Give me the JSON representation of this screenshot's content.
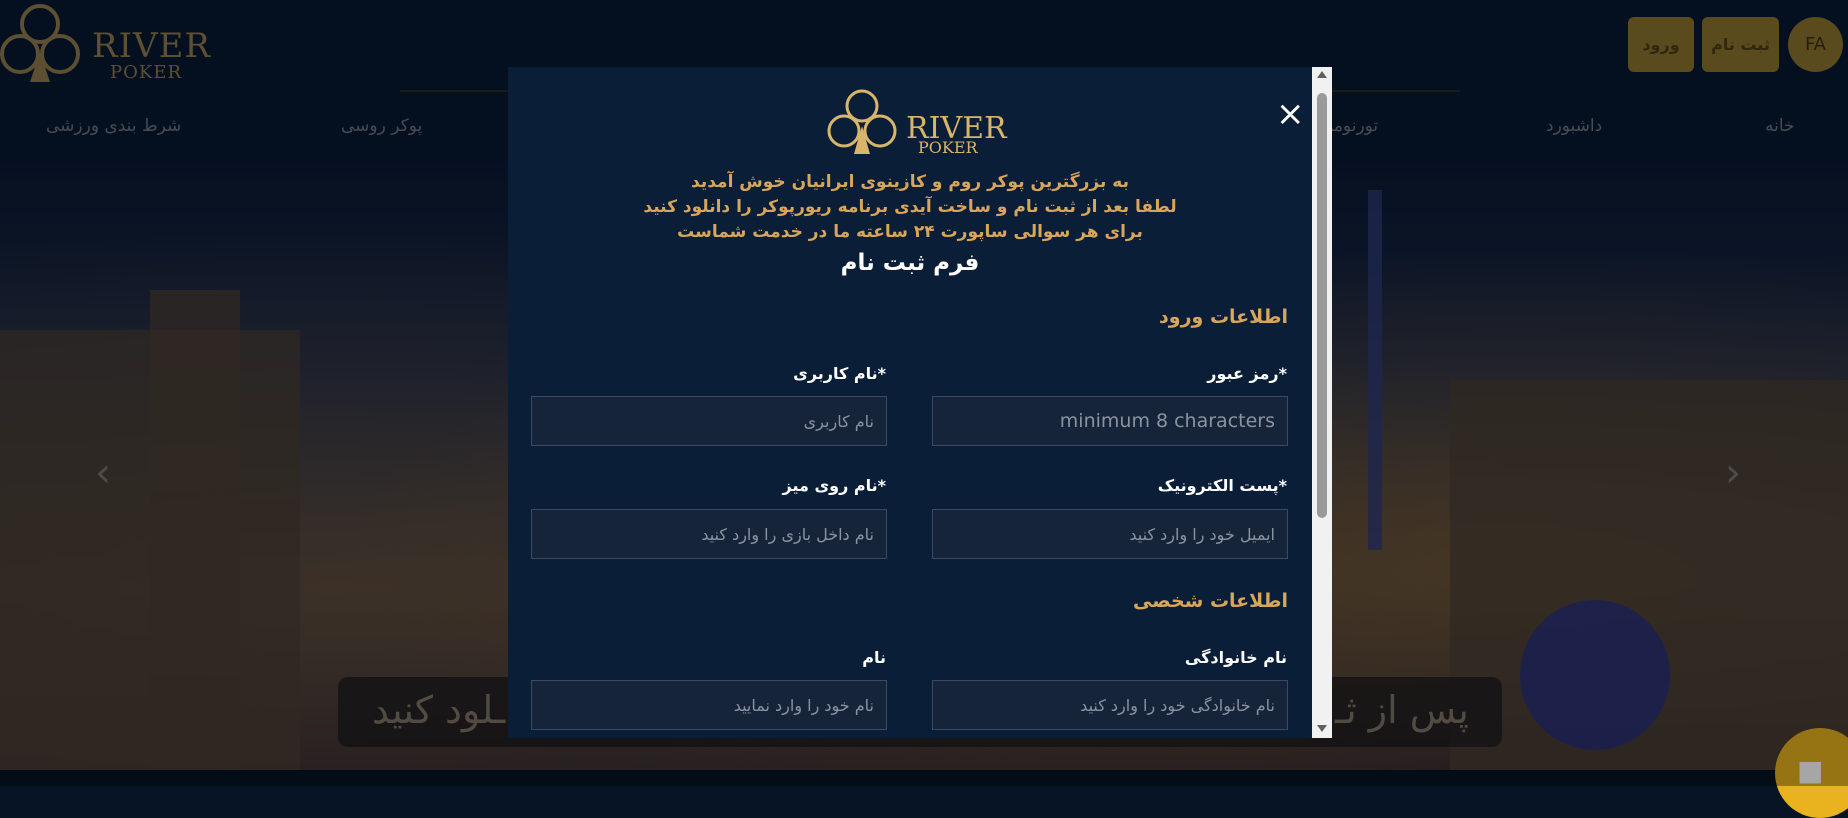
{
  "header": {
    "logo_line1": "RIVER",
    "logo_line2": "POKER",
    "login_label": "ورود",
    "signup_label": "ثبت نام",
    "lang_label": "FA"
  },
  "nav": {
    "items": [
      {
        "label": "خانه"
      },
      {
        "label": "داشبورد"
      },
      {
        "label": "تورنومنت"
      },
      {
        "label": "پوکر روسی"
      },
      {
        "label": "شرط بندی ورزشی"
      }
    ]
  },
  "hero": {
    "banner_right": "پس از ثـ",
    "banner_left": "ـلود کنید"
  },
  "modal": {
    "close_symbol": "×",
    "logo_line1": "RIVER",
    "logo_line2": "POKER",
    "welcome_lines": [
      "به بزرگترین پوکر روم و کازینوی ایرانیان خوش آمدید",
      "لطفا بعد از ثبت نام و ساخت آیدی برنامه ریورپوکر را دانلود کنید",
      "برای هر سوالی ساپورت ۲۴ ساعته ما در خدمت شماست"
    ],
    "form_title": "فرم ثبت نام",
    "login_section": "اطلاعات ورود",
    "personal_section": "اطلاعات شخصی",
    "fields": {
      "password": {
        "label": "*رمز عبور",
        "placeholder": "minimum 8 characters",
        "value": ""
      },
      "username": {
        "label": "*نام کاربری",
        "placeholder": "نام کاربری",
        "value": ""
      },
      "email": {
        "label": "*پست الکترونیک",
        "placeholder": "ایمیل خود را وارد کنید",
        "value": ""
      },
      "table_name": {
        "label": "*نام روی میز",
        "placeholder": "نام داخل بازی را وارد کنید",
        "value": ""
      },
      "last_name": {
        "label": "نام خانوادگی",
        "placeholder": "نام خانوادگی خود را وارد کنید",
        "value": ""
      },
      "first_name": {
        "label": "نام",
        "placeholder": "نام خود را وارد نمایید",
        "value": ""
      }
    }
  },
  "colors": {
    "gold": "#d8a559",
    "modal_bg": "#0b1e38",
    "button_gold": "#8a7330",
    "chat_yellow": "#e8b31e"
  }
}
